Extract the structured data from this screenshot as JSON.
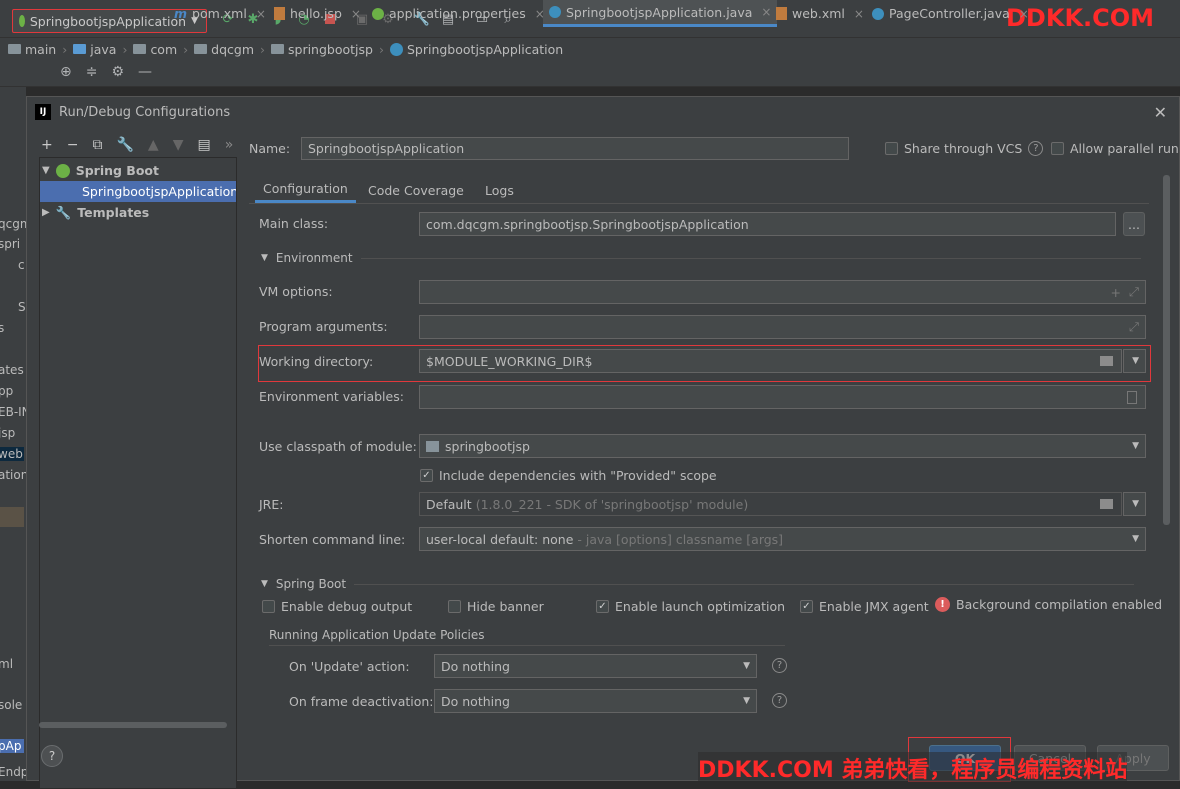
{
  "toolbar": {
    "run_config": "SpringbootjspApplication",
    "watermark_top": "DDKK.COM"
  },
  "breadcrumb": [
    "main",
    "java",
    "com",
    "dqcgm",
    "springbootjsp",
    "SpringbootjspApplication"
  ],
  "editor_tabs": [
    {
      "label": "pom.xml",
      "icon": "maven-icon"
    },
    {
      "label": "hello.jsp",
      "icon": "jsp-icon"
    },
    {
      "label": "application.properties",
      "icon": "spring-properties-icon"
    },
    {
      "label": "SpringbootjspApplication.java",
      "icon": "spring-class-icon"
    },
    {
      "label": "web.xml",
      "icon": "xml-icon"
    },
    {
      "label": "PageController.java",
      "icon": "class-icon"
    }
  ],
  "left_strip_fragments": [
    "qcgm",
    "spri",
    "c",
    "S",
    "s",
    "ates",
    "pp",
    "EB-IN",
    "jsp",
    "web",
    "ation",
    "ml",
    "sole",
    "pAp",
    "Endp"
  ],
  "dialog": {
    "title": "Run/Debug Configurations",
    "tree": {
      "spring_boot": "Spring Boot",
      "config_item": "SpringbootjspApplication",
      "templates": "Templates"
    },
    "name_label": "Name:",
    "name_value": "SpringbootjspApplication",
    "share_vcs": "Share through VCS",
    "allow_parallel": "Allow parallel run",
    "tabs": [
      "Configuration",
      "Code Coverage",
      "Logs"
    ],
    "main_class_label": "Main class:",
    "main_class_value": "com.dqcgm.springbootjsp.SpringbootjspApplication",
    "main_class_button": "...",
    "environment_section": "Environment",
    "vm_options_label": "VM options:",
    "program_args_label": "Program arguments:",
    "working_dir_label": "Working directory:",
    "working_dir_value": "$MODULE_WORKING_DIR$",
    "env_vars_label": "Environment variables:",
    "classpath_label": "Use classpath of module:",
    "classpath_value": "springbootjsp",
    "include_deps": "Include dependencies with \"Provided\" scope",
    "jre_label": "JRE:",
    "jre_value_main": "Default",
    "jre_value_detail": "(1.8.0_221 - SDK of 'springbootjsp' module)",
    "shorten_label": "Shorten command line:",
    "shorten_value_main": "user-local default: none",
    "shorten_value_detail": " - java [options] classname [args]",
    "spring_boot_section": "Spring Boot",
    "enable_debug": "Enable debug output",
    "hide_banner": "Hide banner",
    "enable_launch": "Enable launch optimization",
    "enable_jmx": "Enable JMX agent",
    "bg_compilation": "Background compilation enabled",
    "update_policies": "Running Application Update Policies",
    "on_update_label": "On 'Update' action:",
    "on_update_value": "Do nothing",
    "on_frame_label": "On frame deactivation:",
    "on_frame_value": "Do nothing",
    "ok": "OK",
    "cancel": "Cancel",
    "apply": "Apply"
  },
  "watermark_bottom": "DDKK.COM 弟弟快看，程序员编程资料站",
  "colors": {
    "accent": "#4a88c7",
    "selection": "#4b6eaf",
    "highlight": "#e0383c",
    "watermark": "#ff2a2a"
  }
}
